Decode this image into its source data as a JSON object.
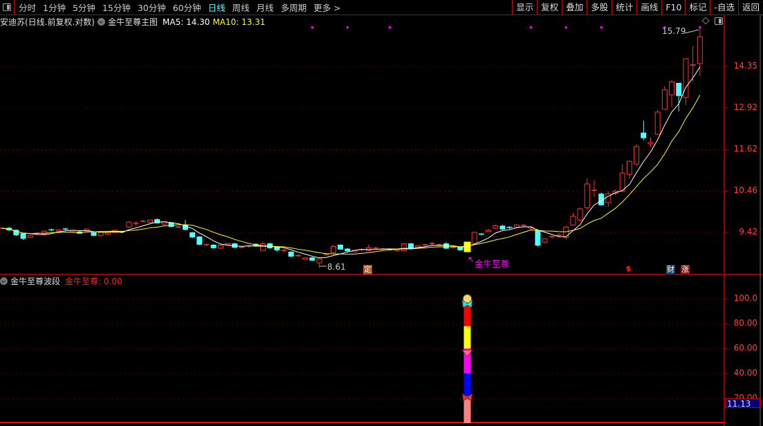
{
  "toolbar": {
    "periods": [
      "分时",
      "1分钟",
      "5分钟",
      "15分钟",
      "30分钟",
      "60分钟",
      "日线",
      "周线",
      "月线",
      "多周期",
      "更多 >"
    ],
    "active_period": "日线",
    "buttons": [
      "显示",
      "复权",
      "叠加",
      "多股",
      "统计",
      "画线",
      "F10",
      "标记",
      "-自选",
      "返回"
    ]
  },
  "main_chart": {
    "title": "安迪苏(日线.前复权.对数)",
    "indicator": "金牛至尊主图",
    "ma5_label": "MA5: 14.30",
    "ma10_label": "MA10: 13.31",
    "high_label": "15.79",
    "low_label": "8.61",
    "signal_label": "金牛至尊",
    "markers": {
      "ding": "定",
      "dollar": "$",
      "cai": "财",
      "zhang": "涨"
    },
    "price_ticks": [
      "14.35",
      "12.92",
      "11.62",
      "10.46",
      "9.42"
    ]
  },
  "sub_chart": {
    "title": "金牛至尊波段",
    "value_label": "金牛至尊: 0.00",
    "ticks": [
      "100.0",
      "80.00",
      "60.00",
      "40.00",
      "20.00"
    ],
    "cursor_value": "11.13"
  },
  "colors": {
    "up": "#ff3232",
    "down": "#54ffff",
    "ma5": "#ffffff",
    "ma10": "#ffff00",
    "grid": "#8b0000",
    "border": "#c00000",
    "signal": "#ff00ff"
  },
  "chart_data": {
    "type": "candlestick",
    "scale": "log",
    "ohlc": [
      [
        9.52,
        9.52,
        9.54,
        9.5
      ],
      [
        9.53,
        9.47,
        9.55,
        9.45
      ],
      [
        9.48,
        9.35,
        9.49,
        9.33
      ],
      [
        9.4,
        9.27,
        9.41,
        9.24
      ],
      [
        9.3,
        9.35,
        9.36,
        9.28
      ],
      [
        9.4,
        9.4,
        9.43,
        9.37
      ],
      [
        9.38,
        9.45,
        9.47,
        9.36
      ],
      [
        9.48,
        9.47,
        9.51,
        9.45
      ],
      [
        9.44,
        9.48,
        9.49,
        9.42
      ],
      [
        9.5,
        9.49,
        9.53,
        9.47
      ],
      [
        9.44,
        9.47,
        9.48,
        9.43
      ],
      [
        9.44,
        9.39,
        9.45,
        9.38
      ],
      [
        9.45,
        9.5,
        9.51,
        9.44
      ],
      [
        9.42,
        9.34,
        9.43,
        9.33
      ],
      [
        9.35,
        9.42,
        9.43,
        9.34
      ],
      [
        9.38,
        9.44,
        9.46,
        9.37
      ],
      [
        9.42,
        9.47,
        9.48,
        9.41
      ],
      [
        9.45,
        9.42,
        9.46,
        9.4
      ],
      [
        9.55,
        9.67,
        9.69,
        9.54
      ],
      [
        9.64,
        9.64,
        9.69,
        9.58
      ],
      [
        9.69,
        9.69,
        9.72,
        9.66
      ],
      [
        9.66,
        9.72,
        9.73,
        9.65
      ],
      [
        9.74,
        9.64,
        9.76,
        9.63
      ],
      [
        9.62,
        9.68,
        9.69,
        9.6
      ],
      [
        9.66,
        9.55,
        9.67,
        9.54
      ],
      [
        9.55,
        9.55,
        9.57,
        9.53
      ],
      [
        9.6,
        9.48,
        9.72,
        9.47
      ],
      [
        9.42,
        9.3,
        9.43,
        9.28
      ],
      [
        9.32,
        9.13,
        9.33,
        9.12
      ],
      [
        9.13,
        9.13,
        9.16,
        9.1
      ],
      [
        9.13,
        9.05,
        9.14,
        9.04
      ],
      [
        9.05,
        9.12,
        9.13,
        9.03
      ],
      [
        9.13,
        9.16,
        9.17,
        9.12
      ],
      [
        9.16,
        9.06,
        9.17,
        9.05
      ],
      [
        9.06,
        9.07,
        9.1,
        9.05
      ],
      [
        9.1,
        9.1,
        9.12,
        9.06
      ],
      [
        9.15,
        9.1,
        9.16,
        9.08
      ],
      [
        9.0,
        9.15,
        9.2,
        8.99
      ],
      [
        9.16,
        9.05,
        9.18,
        9.04
      ],
      [
        9.09,
        9.0,
        9.1,
        8.97
      ],
      [
        9.0,
        9.0,
        9.03,
        8.96
      ],
      [
        8.97,
        8.86,
        8.98,
        8.84
      ],
      [
        8.88,
        8.88,
        8.92,
        8.85
      ],
      [
        8.8,
        8.83,
        8.84,
        8.79
      ],
      [
        8.84,
        8.77,
        8.85,
        8.76
      ],
      [
        8.72,
        8.81,
        8.83,
        8.61
      ],
      [
        8.91,
        8.91,
        8.93,
        8.88
      ],
      [
        8.95,
        9.09,
        9.12,
        8.93
      ],
      [
        9.13,
        9.02,
        9.14,
        9.01
      ],
      [
        9.04,
        8.98,
        9.05,
        8.97
      ],
      [
        8.97,
        9.0,
        9.01,
        8.96
      ],
      [
        9.02,
        9.02,
        9.04,
        8.98
      ],
      [
        9.0,
        9.06,
        9.13,
        8.99
      ],
      [
        9.05,
        9.05,
        9.08,
        9.03
      ],
      [
        9.03,
        9.03,
        9.05,
        9.01
      ],
      [
        9.01,
        9.01,
        9.04,
        8.99
      ],
      [
        9.0,
        9.0,
        9.02,
        8.98
      ],
      [
        8.99,
        9.15,
        9.16,
        8.98
      ],
      [
        9.16,
        9.03,
        9.17,
        9.01
      ],
      [
        9.08,
        9.11,
        9.12,
        9.06
      ],
      [
        9.11,
        9.13,
        9.15,
        9.1
      ],
      [
        9.14,
        9.16,
        9.19,
        9.13
      ],
      [
        9.13,
        9.13,
        9.16,
        9.1
      ],
      [
        9.16,
        9.04,
        9.19,
        9.03
      ],
      [
        9.07,
        9.07,
        9.1,
        9.04
      ],
      [
        9.08,
        9.0,
        9.09,
        8.99
      ],
      [
        8.96,
        9.19,
        9.2,
        8.96
      ],
      [
        9.16,
        9.42,
        9.44,
        9.15
      ],
      [
        9.38,
        9.36,
        9.4,
        9.34
      ],
      [
        9.44,
        9.47,
        9.5,
        9.43
      ],
      [
        9.52,
        9.58,
        9.6,
        9.5
      ],
      [
        9.58,
        9.49,
        9.6,
        9.48
      ],
      [
        9.54,
        9.52,
        9.57,
        9.5
      ],
      [
        9.55,
        9.6,
        9.62,
        9.53
      ],
      [
        9.57,
        9.59,
        9.62,
        9.55
      ],
      [
        9.52,
        9.55,
        9.58,
        9.5
      ],
      [
        9.47,
        9.11,
        9.5,
        9.08
      ],
      [
        9.19,
        9.27,
        9.28,
        9.17
      ],
      [
        9.3,
        9.32,
        9.34,
        9.28
      ],
      [
        9.35,
        9.35,
        9.4,
        9.3
      ],
      [
        9.3,
        9.55,
        9.58,
        9.25
      ],
      [
        9.6,
        9.81,
        9.9,
        9.58
      ],
      [
        9.72,
        10.0,
        10.03,
        9.68
      ],
      [
        10.03,
        10.65,
        10.8,
        9.98
      ],
      [
        10.48,
        10.48,
        10.75,
        10.3
      ],
      [
        10.39,
        10.09,
        10.42,
        10.08
      ],
      [
        10.16,
        10.39,
        10.45,
        10.05
      ],
      [
        10.4,
        10.46,
        10.5,
        10.35
      ],
      [
        10.46,
        10.95,
        11.2,
        10.45
      ],
      [
        10.91,
        11.28,
        11.3,
        10.8
      ],
      [
        11.2,
        11.71,
        11.78,
        11.15
      ],
      [
        12.13,
        11.96,
        12.5,
        11.9
      ],
      [
        11.79,
        11.83,
        11.98,
        11.7
      ],
      [
        12.08,
        12.78,
        12.85,
        12.07
      ],
      [
        12.87,
        13.52,
        13.65,
        12.85
      ],
      [
        13.35,
        13.8,
        13.85,
        12.95
      ],
      [
        13.76,
        13.31,
        13.76,
        12.8
      ],
      [
        13.26,
        14.63,
        14.63,
        13.0
      ],
      [
        14.4,
        14.4,
        15.1,
        13.8
      ],
      [
        14.45,
        15.47,
        15.79,
        14.0
      ]
    ],
    "signal_bar_index": 66,
    "top_dot_indices": [
      44,
      49,
      55,
      75,
      80,
      85,
      94,
      99
    ],
    "band_segments": [
      {
        "from": 0,
        "to": 22,
        "color": "#ff8080"
      },
      {
        "from": 22,
        "to": 40,
        "color": "#0000ff"
      },
      {
        "from": 40,
        "to": 60,
        "color": "#ff00ff"
      },
      {
        "from": 60,
        "to": 78,
        "color": "#ffff00"
      },
      {
        "from": 78,
        "to": 95,
        "color": "#ff0000"
      }
    ],
    "band_icons": [
      {
        "name": "money-bag",
        "value": 100
      },
      {
        "name": "butterfly-cyan",
        "value": 96
      },
      {
        "name": "gem",
        "value": 57
      },
      {
        "name": "butterfly-red",
        "value": 21
      }
    ]
  }
}
